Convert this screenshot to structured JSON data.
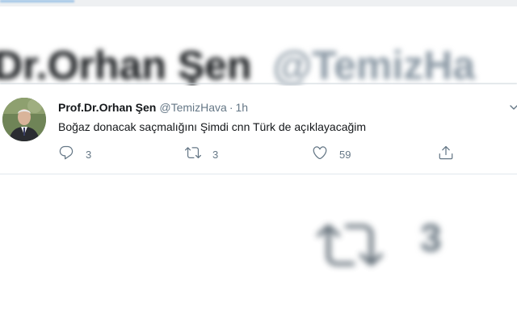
{
  "tweet": {
    "author_name": "Prof.Dr.Orhan Şen",
    "handle": "@TemizHava",
    "separator": "·",
    "time": "1h",
    "text": "Boğaz donacak saçmalığını Şimdi cnn Türk de açıklayacağim",
    "replies": "3",
    "retweets": "3",
    "likes": "59"
  },
  "zoom_background": {
    "name": "Dr.Orhan Şen",
    "handle": "@TemizHa",
    "retweets": "3"
  },
  "colors": {
    "text": "#14171a",
    "secondary": "#657786",
    "border": "#e1e8ed"
  },
  "icons": [
    "reply-icon",
    "retweet-icon",
    "like-icon",
    "share-icon",
    "caret-down-icon"
  ]
}
